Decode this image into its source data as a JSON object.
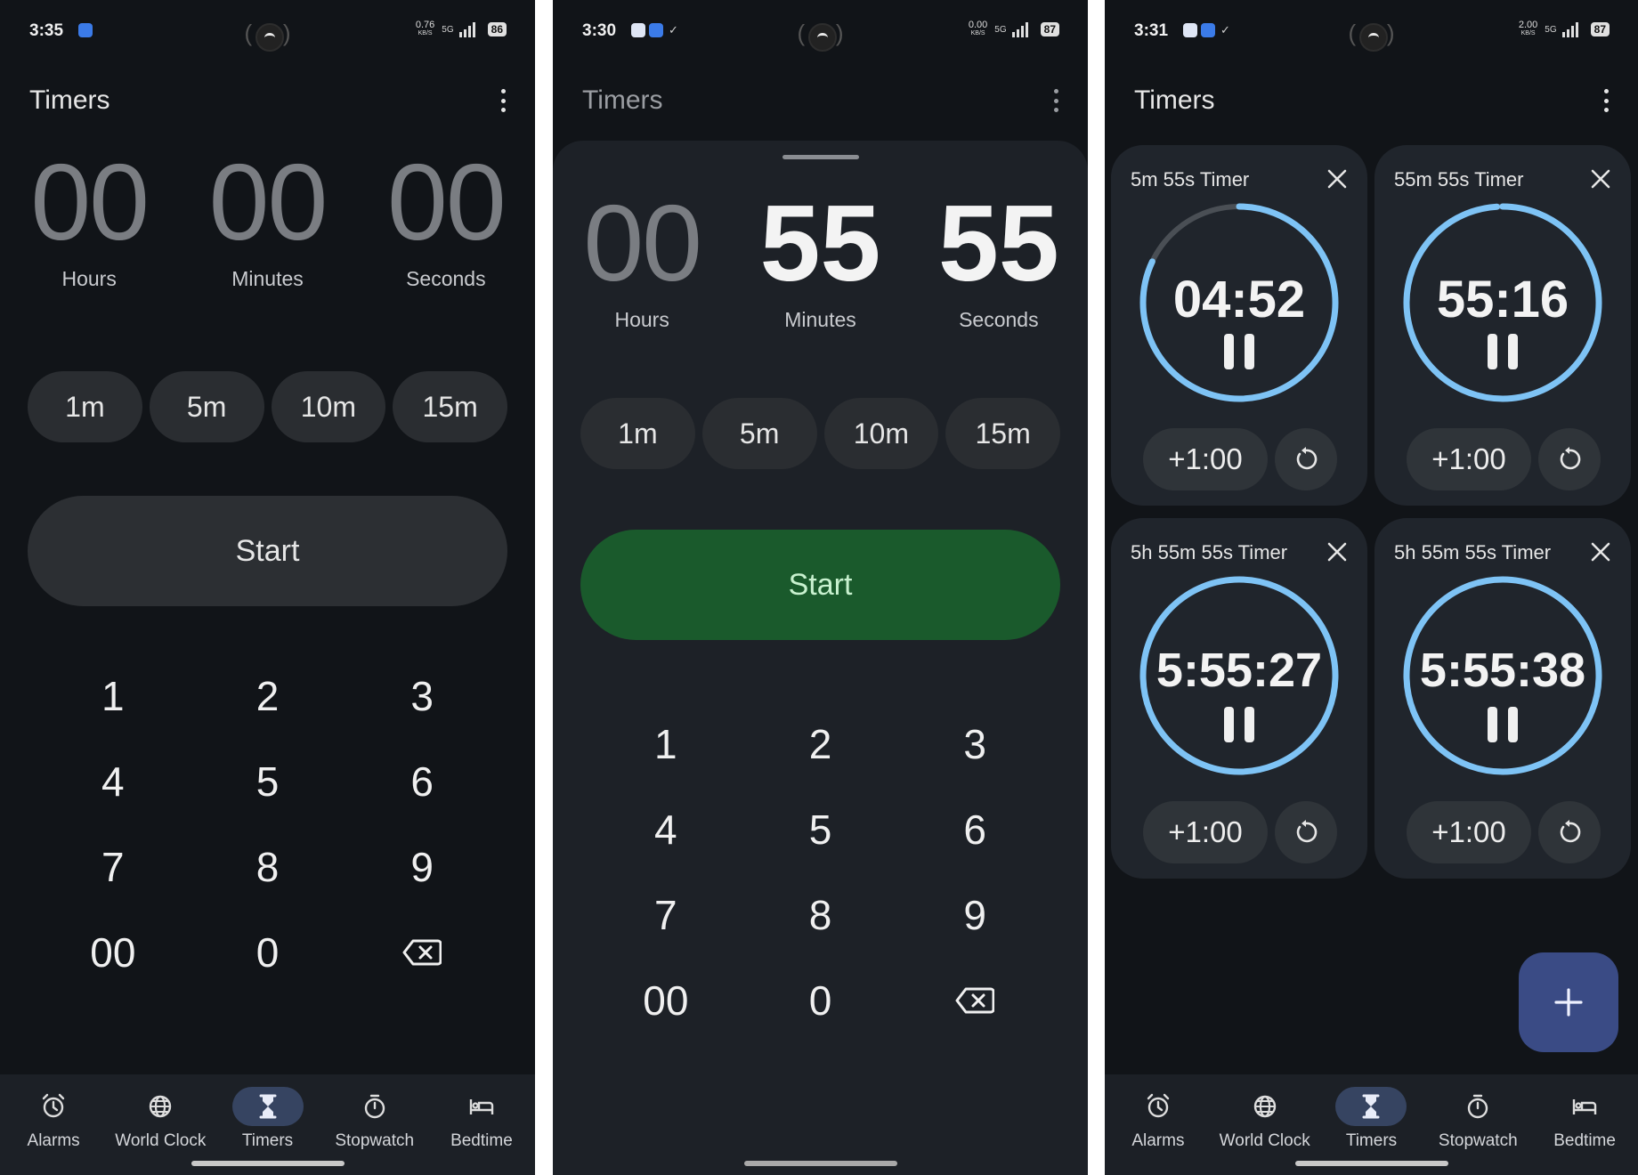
{
  "screens": [
    {
      "status": {
        "time": "3:35",
        "speed": "0.76",
        "speed_unit": "KB/S",
        "network": "5G",
        "battery": "86"
      },
      "title": "Timers",
      "entry": {
        "hours": "00",
        "minutes": "00",
        "seconds": "00",
        "hours_label": "Hours",
        "minutes_label": "Minutes",
        "seconds_label": "Seconds"
      },
      "presets": [
        "1m",
        "5m",
        "10m",
        "15m"
      ],
      "start_label": "Start",
      "keys": [
        "1",
        "2",
        "3",
        "4",
        "5",
        "6",
        "7",
        "8",
        "9",
        "00",
        "0"
      ]
    },
    {
      "status": {
        "time": "3:30",
        "speed": "0.00",
        "speed_unit": "KB/S",
        "network": "5G",
        "battery": "87"
      },
      "title": "Timers",
      "entry": {
        "hours": "00",
        "minutes": "55",
        "seconds": "55",
        "hours_label": "Hours",
        "minutes_label": "Minutes",
        "seconds_label": "Seconds"
      },
      "presets": [
        "1m",
        "5m",
        "10m",
        "15m"
      ],
      "start_label": "Start",
      "keys": [
        "1",
        "2",
        "3",
        "4",
        "5",
        "6",
        "7",
        "8",
        "9",
        "00",
        "0"
      ]
    },
    {
      "status": {
        "time": "3:31",
        "speed": "2.00",
        "speed_unit": "KB/S",
        "network": "5G",
        "battery": "87"
      },
      "title": "Timers",
      "timers": [
        {
          "name": "5m 55s Timer",
          "remaining": "04:52",
          "progress": 0.82,
          "add_label": "+1:00"
        },
        {
          "name": "55m 55s Timer",
          "remaining": "55:16",
          "progress": 0.99,
          "add_label": "+1:00"
        },
        {
          "name": "5h 55m 55s Timer",
          "remaining": "5:55:27",
          "progress": 1.0,
          "add_label": "+1:00"
        },
        {
          "name": "5h 55m 55s Timer",
          "remaining": "5:55:38",
          "progress": 1.0,
          "add_label": "+1:00"
        }
      ]
    }
  ],
  "nav": [
    "Alarms",
    "World Clock",
    "Timers",
    "Stopwatch",
    "Bedtime"
  ],
  "colors": {
    "background": "#111418",
    "start_active": "#1a5a2c",
    "ring": "#7ec3f5",
    "fab": "#3a4b85",
    "nav_active": "#364461"
  },
  "icons": {
    "nav": [
      "alarm-icon",
      "globe-icon",
      "hourglass-icon",
      "stopwatch-icon",
      "bed-icon"
    ],
    "other": [
      "more-vert-icon",
      "backspace-icon",
      "close-icon",
      "pause-icon",
      "reset-icon",
      "plus-icon"
    ]
  }
}
